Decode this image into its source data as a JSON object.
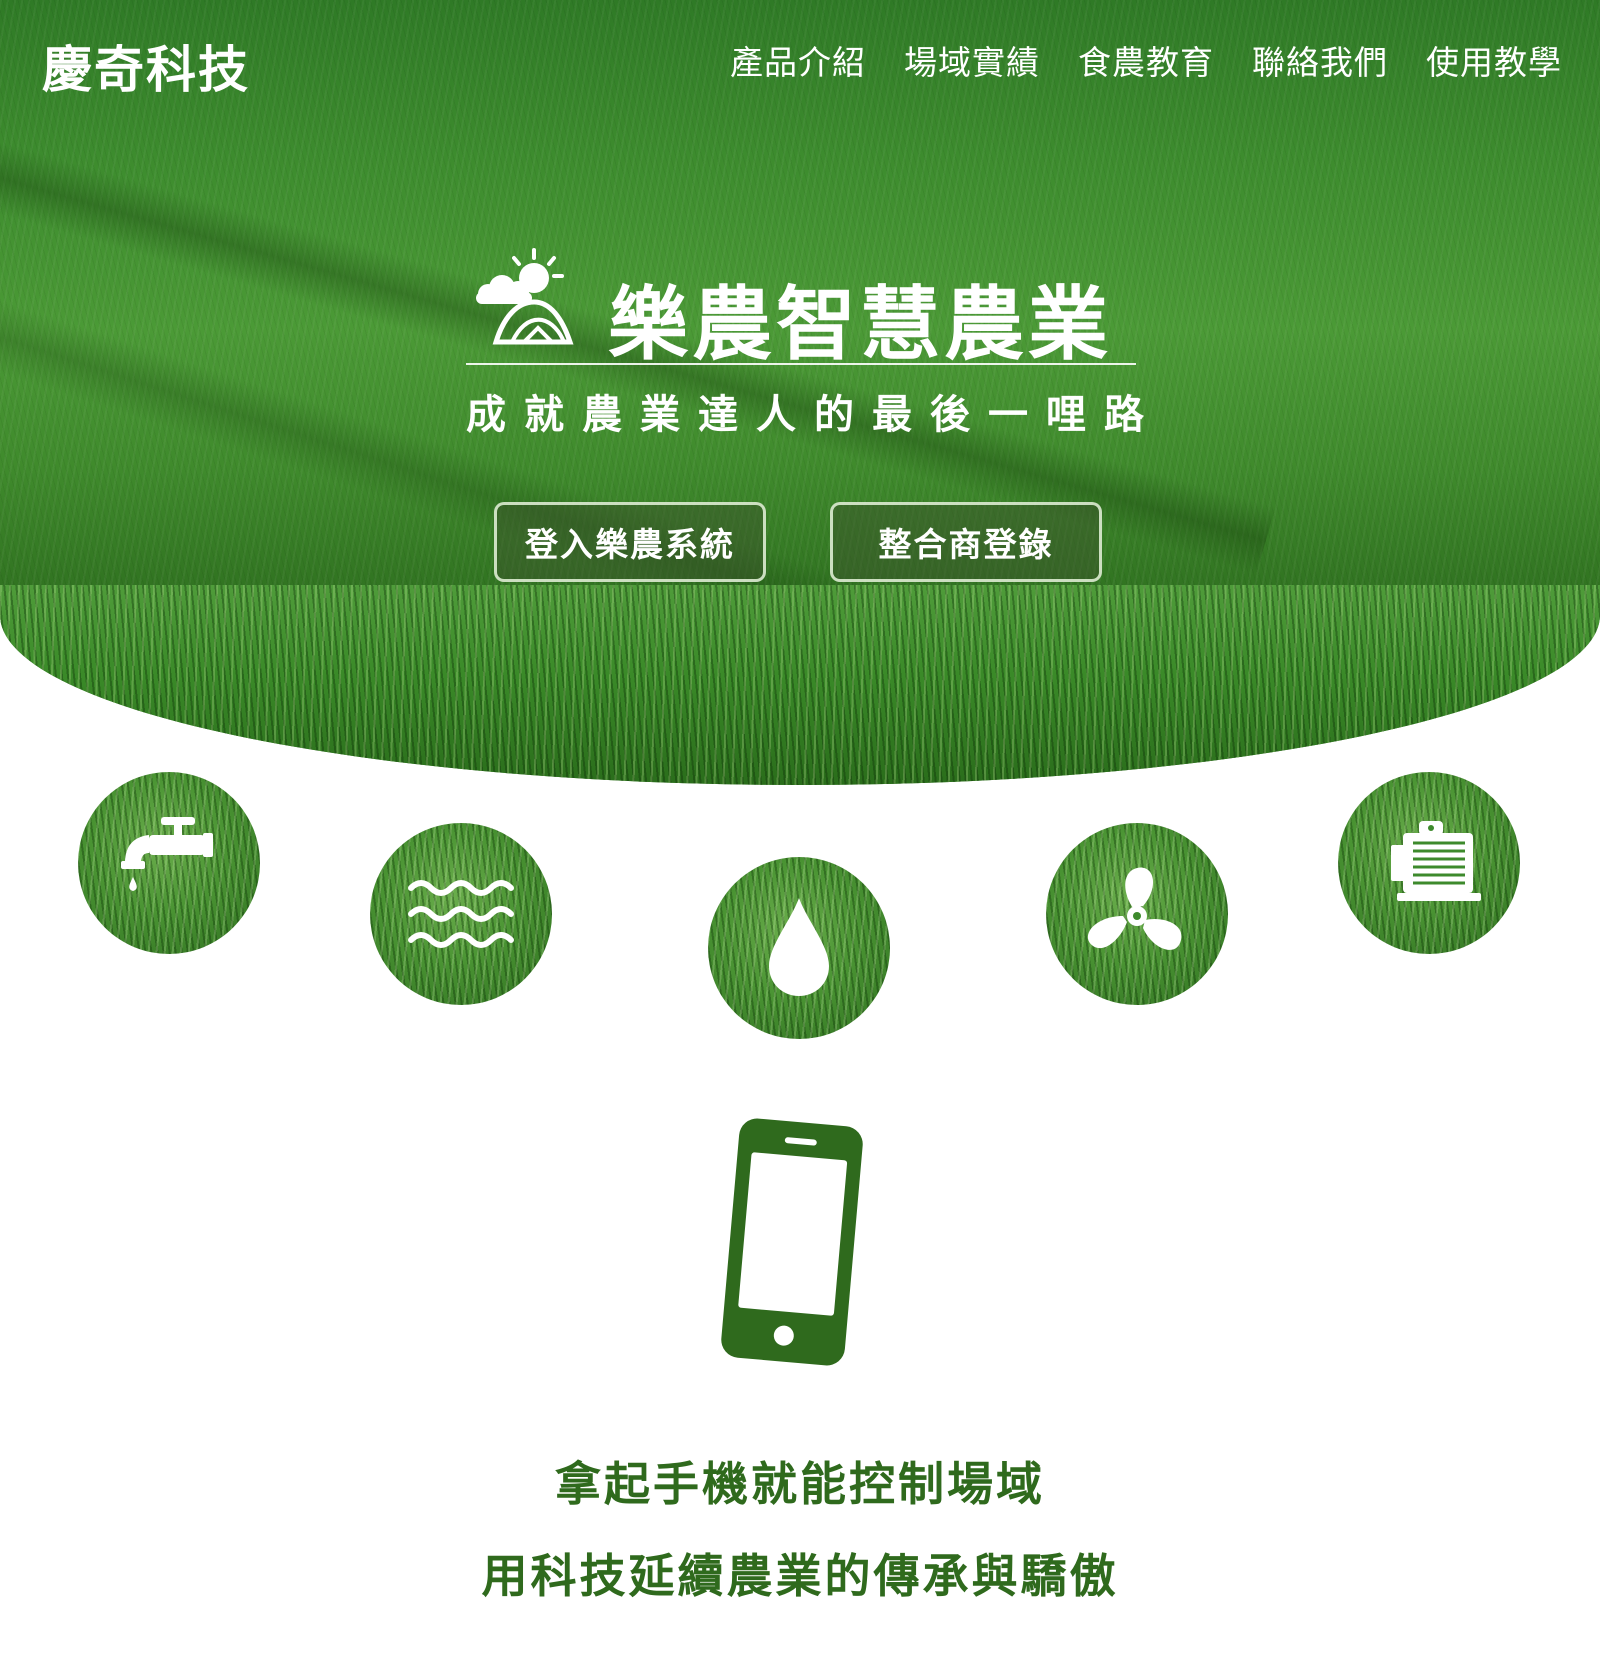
{
  "header": {
    "logo_text": "慶奇科技",
    "nav": [
      {
        "label": "產品介紹"
      },
      {
        "label": "場域實績"
      },
      {
        "label": "食農教育"
      },
      {
        "label": "聯絡我們"
      },
      {
        "label": "使用教學"
      }
    ]
  },
  "hero": {
    "title": "樂農智慧農業",
    "slogan": "成就農業達人的最後一哩路",
    "buttons": {
      "login": "登入樂農系統",
      "partner": "整合商登錄"
    },
    "brand_icon": "sun-cloud-mountain-logo"
  },
  "features": {
    "icons": [
      "faucet-icon",
      "water-waves-icon",
      "water-drop-icon",
      "fan-icon",
      "motor-icon"
    ]
  },
  "phone_section": {
    "icon": "smartphone-icon",
    "line1": "拿起手機就能控制場域",
    "line2": "用科技延續農業的傳承與驕傲"
  },
  "colors": {
    "primary_green": "#2f6a1d",
    "text_on_hero": "#ffffff"
  }
}
